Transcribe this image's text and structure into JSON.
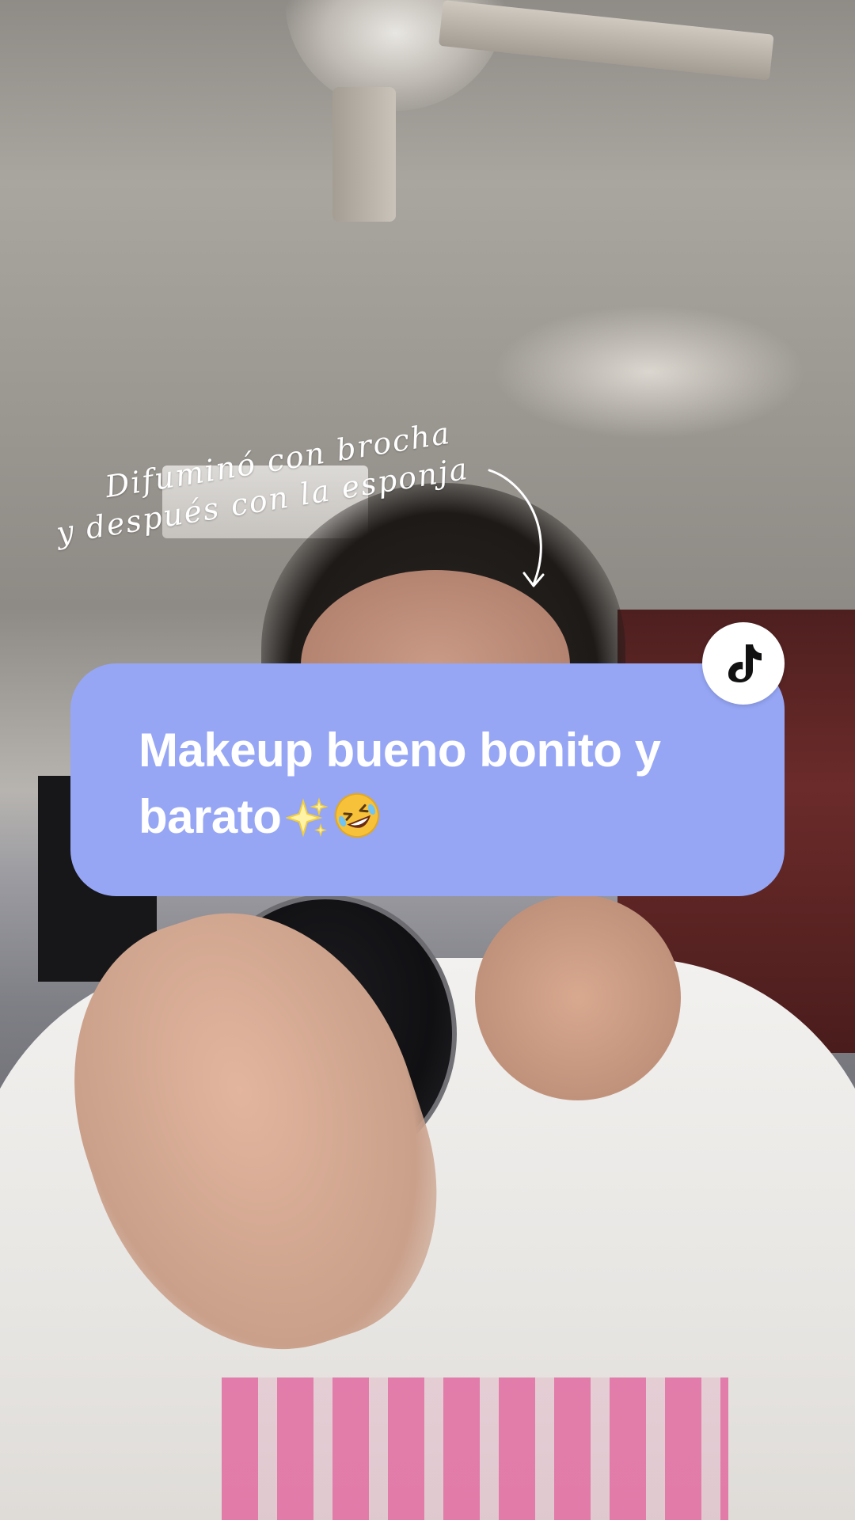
{
  "annotation": {
    "line_one": "Difuminó con brocha",
    "line_two": "y después con la esponja"
  },
  "caption": {
    "text": "Makeup bueno bonito y barato",
    "emoji_1": "sparkles-icon",
    "emoji_2": "rolling-on-floor-laughing-icon"
  },
  "badge": {
    "icon": "tiktok-logo-icon"
  },
  "colors": {
    "caption_bubble": "#96a6f5",
    "caption_text": "#ffffff",
    "badge_bg": "#ffffff",
    "annotation_text": "#ffffff"
  }
}
